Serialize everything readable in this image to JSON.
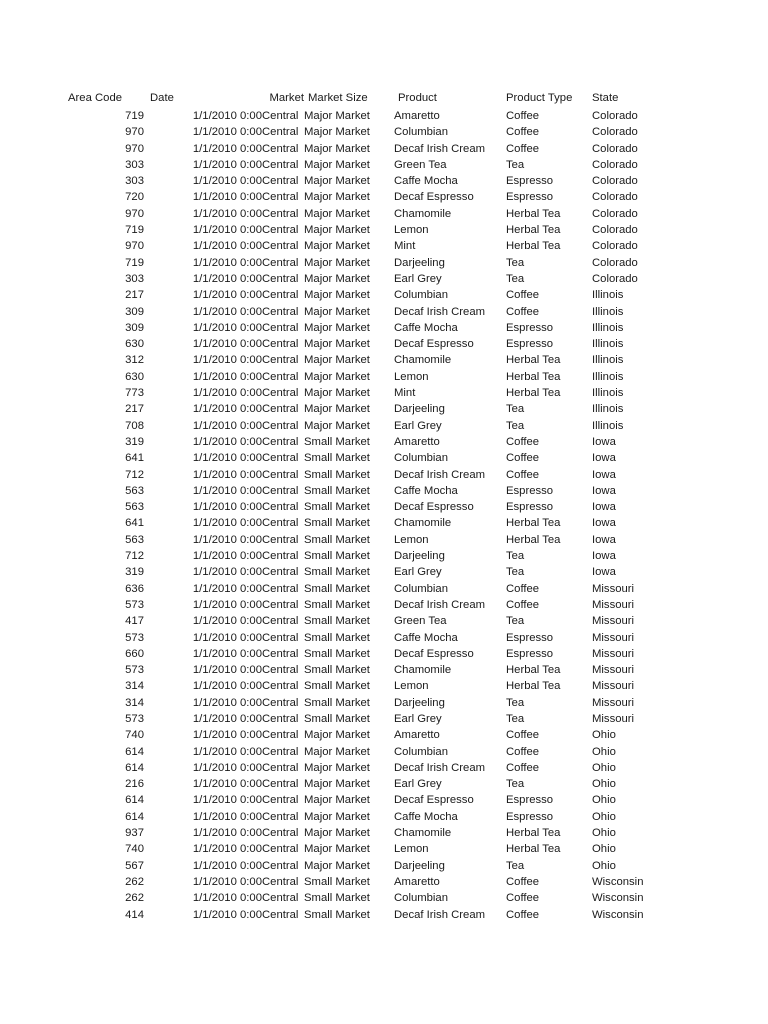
{
  "table": {
    "columns": [
      {
        "key": "area_code",
        "label": "Area Code"
      },
      {
        "key": "date",
        "label": "Date"
      },
      {
        "key": "market",
        "label": "Market"
      },
      {
        "key": "market_size",
        "label": "Market Size"
      },
      {
        "key": "product",
        "label": "Product"
      },
      {
        "key": "product_type",
        "label": "Product Type"
      },
      {
        "key": "state",
        "label": "State"
      }
    ],
    "rows": [
      [
        "719",
        "1/1/2010 0:00",
        "Central",
        "Major Market",
        "Amaretto",
        "Coffee",
        "Colorado"
      ],
      [
        "970",
        "1/1/2010 0:00",
        "Central",
        "Major Market",
        "Columbian",
        "Coffee",
        "Colorado"
      ],
      [
        "970",
        "1/1/2010 0:00",
        "Central",
        "Major Market",
        "Decaf Irish Cream",
        "Coffee",
        "Colorado"
      ],
      [
        "303",
        "1/1/2010 0:00",
        "Central",
        "Major Market",
        "Green Tea",
        "Tea",
        "Colorado"
      ],
      [
        "303",
        "1/1/2010 0:00",
        "Central",
        "Major Market",
        "Caffe Mocha",
        "Espresso",
        "Colorado"
      ],
      [
        "720",
        "1/1/2010 0:00",
        "Central",
        "Major Market",
        "Decaf Espresso",
        "Espresso",
        "Colorado"
      ],
      [
        "970",
        "1/1/2010 0:00",
        "Central",
        "Major Market",
        "Chamomile",
        "Herbal Tea",
        "Colorado"
      ],
      [
        "719",
        "1/1/2010 0:00",
        "Central",
        "Major Market",
        "Lemon",
        "Herbal Tea",
        "Colorado"
      ],
      [
        "970",
        "1/1/2010 0:00",
        "Central",
        "Major Market",
        "Mint",
        "Herbal Tea",
        "Colorado"
      ],
      [
        "719",
        "1/1/2010 0:00",
        "Central",
        "Major Market",
        "Darjeeling",
        "Tea",
        "Colorado"
      ],
      [
        "303",
        "1/1/2010 0:00",
        "Central",
        "Major Market",
        "Earl Grey",
        "Tea",
        "Colorado"
      ],
      [
        "217",
        "1/1/2010 0:00",
        "Central",
        "Major Market",
        "Columbian",
        "Coffee",
        "Illinois"
      ],
      [
        "309",
        "1/1/2010 0:00",
        "Central",
        "Major Market",
        "Decaf Irish Cream",
        "Coffee",
        "Illinois"
      ],
      [
        "309",
        "1/1/2010 0:00",
        "Central",
        "Major Market",
        "Caffe Mocha",
        "Espresso",
        "Illinois"
      ],
      [
        "630",
        "1/1/2010 0:00",
        "Central",
        "Major Market",
        "Decaf Espresso",
        "Espresso",
        "Illinois"
      ],
      [
        "312",
        "1/1/2010 0:00",
        "Central",
        "Major Market",
        "Chamomile",
        "Herbal Tea",
        "Illinois"
      ],
      [
        "630",
        "1/1/2010 0:00",
        "Central",
        "Major Market",
        "Lemon",
        "Herbal Tea",
        "Illinois"
      ],
      [
        "773",
        "1/1/2010 0:00",
        "Central",
        "Major Market",
        "Mint",
        "Herbal Tea",
        "Illinois"
      ],
      [
        "217",
        "1/1/2010 0:00",
        "Central",
        "Major Market",
        "Darjeeling",
        "Tea",
        "Illinois"
      ],
      [
        "708",
        "1/1/2010 0:00",
        "Central",
        "Major Market",
        "Earl Grey",
        "Tea",
        "Illinois"
      ],
      [
        "319",
        "1/1/2010 0:00",
        "Central",
        "Small Market",
        "Amaretto",
        "Coffee",
        "Iowa"
      ],
      [
        "641",
        "1/1/2010 0:00",
        "Central",
        "Small Market",
        "Columbian",
        "Coffee",
        "Iowa"
      ],
      [
        "712",
        "1/1/2010 0:00",
        "Central",
        "Small Market",
        "Decaf Irish Cream",
        "Coffee",
        "Iowa"
      ],
      [
        "563",
        "1/1/2010 0:00",
        "Central",
        "Small Market",
        "Caffe Mocha",
        "Espresso",
        "Iowa"
      ],
      [
        "563",
        "1/1/2010 0:00",
        "Central",
        "Small Market",
        "Decaf Espresso",
        "Espresso",
        "Iowa"
      ],
      [
        "641",
        "1/1/2010 0:00",
        "Central",
        "Small Market",
        "Chamomile",
        "Herbal Tea",
        "Iowa"
      ],
      [
        "563",
        "1/1/2010 0:00",
        "Central",
        "Small Market",
        "Lemon",
        "Herbal Tea",
        "Iowa"
      ],
      [
        "712",
        "1/1/2010 0:00",
        "Central",
        "Small Market",
        "Darjeeling",
        "Tea",
        "Iowa"
      ],
      [
        "319",
        "1/1/2010 0:00",
        "Central",
        "Small Market",
        "Earl Grey",
        "Tea",
        "Iowa"
      ],
      [
        "636",
        "1/1/2010 0:00",
        "Central",
        "Small Market",
        "Columbian",
        "Coffee",
        "Missouri"
      ],
      [
        "573",
        "1/1/2010 0:00",
        "Central",
        "Small Market",
        "Decaf Irish Cream",
        "Coffee",
        "Missouri"
      ],
      [
        "417",
        "1/1/2010 0:00",
        "Central",
        "Small Market",
        "Green Tea",
        "Tea",
        "Missouri"
      ],
      [
        "573",
        "1/1/2010 0:00",
        "Central",
        "Small Market",
        "Caffe Mocha",
        "Espresso",
        "Missouri"
      ],
      [
        "660",
        "1/1/2010 0:00",
        "Central",
        "Small Market",
        "Decaf Espresso",
        "Espresso",
        "Missouri"
      ],
      [
        "573",
        "1/1/2010 0:00",
        "Central",
        "Small Market",
        "Chamomile",
        "Herbal Tea",
        "Missouri"
      ],
      [
        "314",
        "1/1/2010 0:00",
        "Central",
        "Small Market",
        "Lemon",
        "Herbal Tea",
        "Missouri"
      ],
      [
        "314",
        "1/1/2010 0:00",
        "Central",
        "Small Market",
        "Darjeeling",
        "Tea",
        "Missouri"
      ],
      [
        "573",
        "1/1/2010 0:00",
        "Central",
        "Small Market",
        "Earl Grey",
        "Tea",
        "Missouri"
      ],
      [
        "740",
        "1/1/2010 0:00",
        "Central",
        "Major Market",
        "Amaretto",
        "Coffee",
        "Ohio"
      ],
      [
        "614",
        "1/1/2010 0:00",
        "Central",
        "Major Market",
        "Columbian",
        "Coffee",
        "Ohio"
      ],
      [
        "614",
        "1/1/2010 0:00",
        "Central",
        "Major Market",
        "Decaf Irish Cream",
        "Coffee",
        "Ohio"
      ],
      [
        "216",
        "1/1/2010 0:00",
        "Central",
        "Major Market",
        "Earl Grey",
        "Tea",
        "Ohio"
      ],
      [
        "614",
        "1/1/2010 0:00",
        "Central",
        "Major Market",
        "Decaf Espresso",
        "Espresso",
        "Ohio"
      ],
      [
        "614",
        "1/1/2010 0:00",
        "Central",
        "Major Market",
        "Caffe Mocha",
        "Espresso",
        "Ohio"
      ],
      [
        "937",
        "1/1/2010 0:00",
        "Central",
        "Major Market",
        "Chamomile",
        "Herbal Tea",
        "Ohio"
      ],
      [
        "740",
        "1/1/2010 0:00",
        "Central",
        "Major Market",
        "Lemon",
        "Herbal Tea",
        "Ohio"
      ],
      [
        "567",
        "1/1/2010 0:00",
        "Central",
        "Major Market",
        "Darjeeling",
        "Tea",
        "Ohio"
      ],
      [
        "262",
        "1/1/2010 0:00",
        "Central",
        "Small Market",
        "Amaretto",
        "Coffee",
        "Wisconsin"
      ],
      [
        "262",
        "1/1/2010 0:00",
        "Central",
        "Small Market",
        "Columbian",
        "Coffee",
        "Wisconsin"
      ],
      [
        "414",
        "1/1/2010 0:00",
        "Central",
        "Small Market",
        "Decaf Irish Cream",
        "Coffee",
        "Wisconsin"
      ]
    ]
  }
}
